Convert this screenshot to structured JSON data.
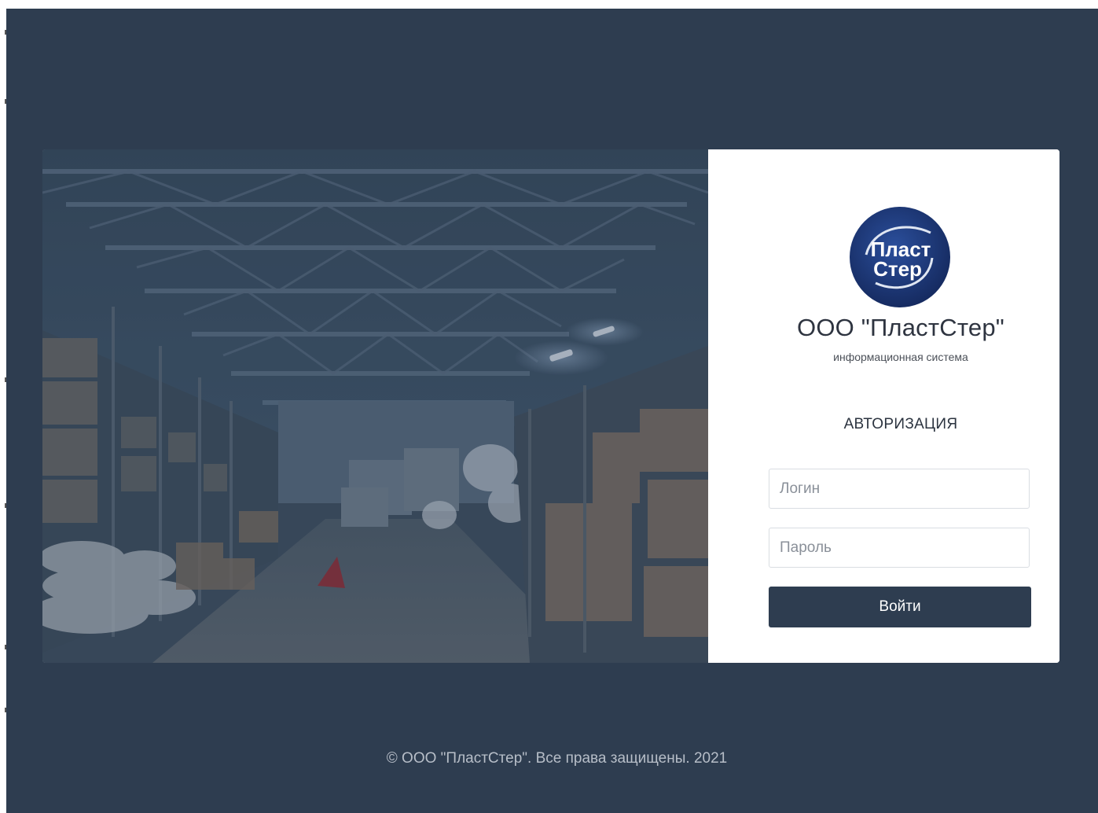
{
  "brand": {
    "logo_line1": "Пласт",
    "logo_line2": "Стер",
    "title": "ООО \"ПластСтер\"",
    "subtitle": "информационная система"
  },
  "auth": {
    "heading": "АВТОРИЗАЦИЯ",
    "login_placeholder": "Логин",
    "login_value": "",
    "password_placeholder": "Пароль",
    "password_value": "",
    "submit_label": "Войти"
  },
  "footer": {
    "symbol": "©",
    "text": "ООО \"ПластСтер\". Все права защищены. 2021"
  },
  "colors": {
    "background": "#2e3d50",
    "button": "#2e3d50",
    "panel": "#ffffff",
    "logo": "#1f3a7a"
  },
  "icons": {
    "logo": "plastster-logo-icon",
    "hero": "warehouse-photo"
  }
}
